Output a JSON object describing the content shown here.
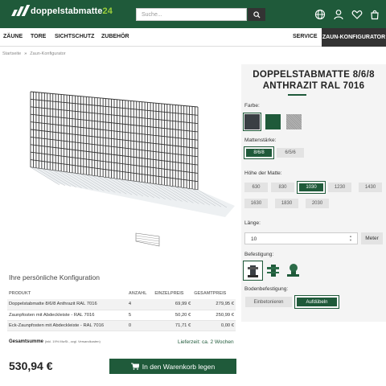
{
  "header": {
    "logo_text": "doppelstabmatte",
    "logo_num": "24",
    "search_placeholder": "Suche...",
    "icons": [
      "search-icon",
      "globe-icon",
      "user-icon",
      "heart-icon",
      "cart-icon"
    ]
  },
  "nav": {
    "items": [
      "ZÄUNE",
      "TORE",
      "SICHTSCHUTZ",
      "ZUBEHÖR"
    ],
    "service": "SERVICE",
    "configurator": "ZAUN-KONFIGURATOR"
  },
  "breadcrumb": {
    "home": "Startseite",
    "sep": "»",
    "current": "Zaun-Konfigurator"
  },
  "product": {
    "title_line1": "DOPPELSTABMATTE 8/6/8",
    "title_line2": "ANTHRAZIT RAL 7016"
  },
  "config": {
    "color_label": "Farbe:",
    "colors": [
      {
        "name": "anthrazit",
        "hex": "#3a3f44",
        "selected": true
      },
      {
        "name": "gruen",
        "hex": "#1f5a3a",
        "selected": false
      },
      {
        "name": "verzinkt",
        "hex": "#b0b0b0",
        "selected": false
      }
    ],
    "thickness_label": "Mattenstärke:",
    "thickness": [
      {
        "label": "8/6/8",
        "selected": true
      },
      {
        "label": "6/5/6",
        "selected": false
      }
    ],
    "height_label": "Höhe der Matte:",
    "heights": [
      {
        "label": "630",
        "selected": false
      },
      {
        "label": "830",
        "selected": false
      },
      {
        "label": "1030",
        "selected": true
      },
      {
        "label": "1230",
        "selected": false
      },
      {
        "label": "1430",
        "selected": false
      },
      {
        "label": "1630",
        "selected": false
      },
      {
        "label": "1830",
        "selected": false
      },
      {
        "label": "2030",
        "selected": false
      }
    ],
    "length_label": "Länge:",
    "length_value": "10",
    "length_unit": "Meter",
    "mount_label": "Befestigung:",
    "floor_label": "Bodenbefestigung:",
    "floor_options": [
      {
        "label": "Einbetonieren",
        "selected": false
      },
      {
        "label": "Aufdübeln",
        "selected": true
      }
    ]
  },
  "summary": {
    "title": "Ihre persönliche Konfiguration",
    "headers": [
      "PRODUKT",
      "ANZAHL",
      "EINZELPREIS",
      "GESAMTPREIS"
    ],
    "rows": [
      [
        "Doppelstabmatte 8/6/8 Anthrazit RAL 7016",
        "4",
        "69,99 €",
        "279,95 €"
      ],
      [
        "Zaunpfosten mit Abdeckleiste - RAL 7016",
        "5",
        "50,20 €",
        "250,99 €"
      ],
      [
        "Eck-Zaunpfosten mit Abdeckleiste - RAL 7016",
        "0",
        "71,71 €",
        "0,00 €"
      ]
    ],
    "total_label": "Gesamtsumme",
    "total_note": "(inkl. 19% MwSt., zzgl. Versandkosten)",
    "delivery": "Lieferzeit: ca. 2 Wochen",
    "total_price": "530,94 €",
    "cart_button": "In den Warenkorb legen"
  }
}
